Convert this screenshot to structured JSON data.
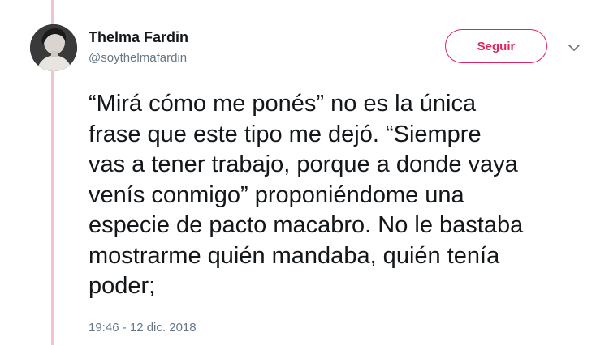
{
  "tweet": {
    "author": {
      "name": "Thelma Fardin",
      "handle": "@soythelmafardin"
    },
    "follow_label": "Seguir",
    "lines": [
      "“Mirá cómo me ponés” no es la única",
      "frase que este tipo me dejó. “Siempre",
      "vas a tener trabajo, porque a donde vaya",
      "venís conmigo” proponiéndome una",
      "especie de pacto macabro. No le bastaba",
      "mostrarme quién mandaba, quién tenía",
      "poder;"
    ],
    "timestamp": "19:46 - 12 dic. 2018"
  },
  "colors": {
    "accent": "#e0245e",
    "thread_line": "#f2c4cf",
    "secondary_text": "#657786",
    "primary_text": "#14171a"
  },
  "icons": {
    "menu": "chevron-down-icon",
    "avatar": "profile-photo"
  }
}
